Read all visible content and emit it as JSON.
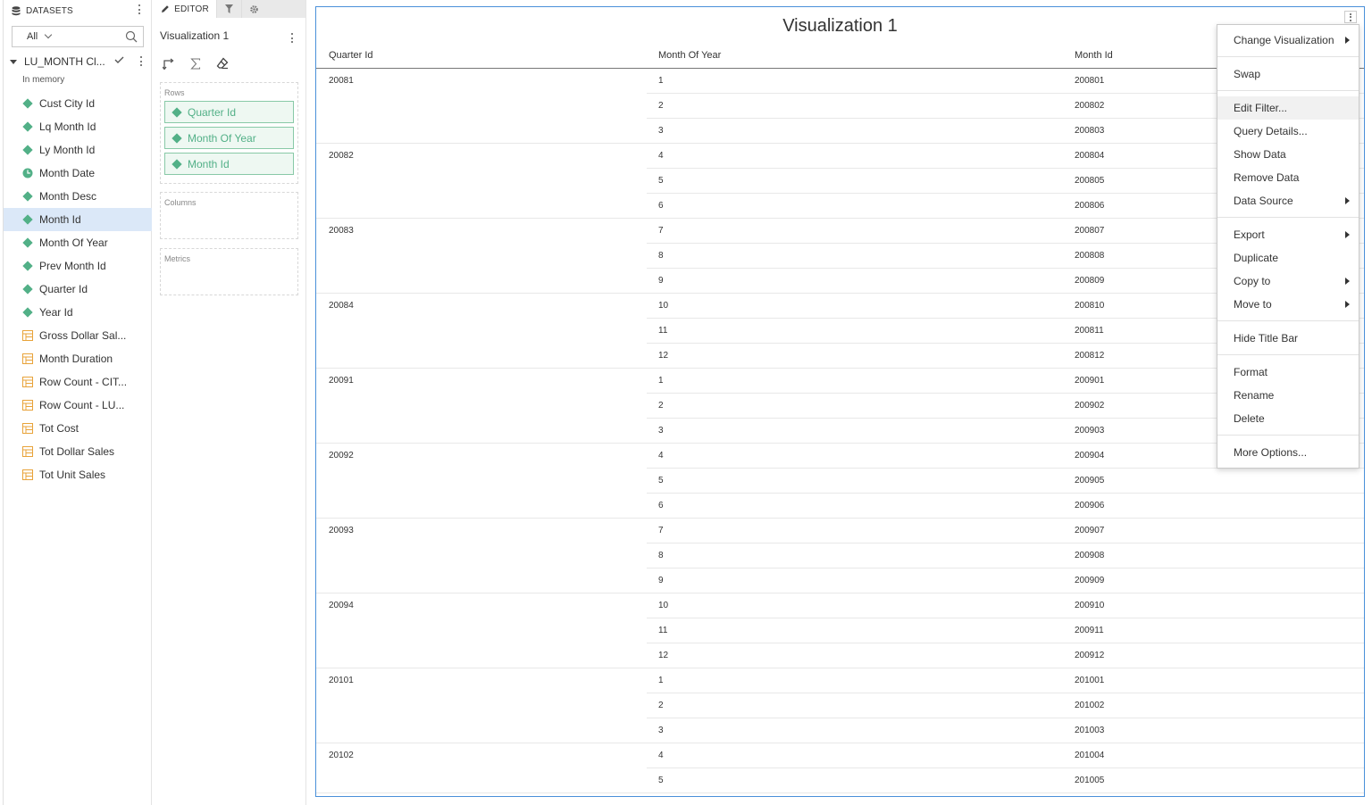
{
  "datasets_panel": {
    "header": "DATASETS",
    "filter_value": "All",
    "dataset_name": "LU_MONTH Cl...",
    "dataset_status": "In memory",
    "fields": [
      {
        "label": "Cust City Id",
        "type": "attribute"
      },
      {
        "label": "Lq Month Id",
        "type": "attribute"
      },
      {
        "label": "Ly Month Id",
        "type": "attribute"
      },
      {
        "label": "Month Date",
        "type": "time"
      },
      {
        "label": "Month Desc",
        "type": "attribute"
      },
      {
        "label": "Month Id",
        "type": "attribute",
        "selected": true
      },
      {
        "label": "Month Of Year",
        "type": "attribute"
      },
      {
        "label": "Prev Month Id",
        "type": "attribute"
      },
      {
        "label": "Quarter Id",
        "type": "attribute"
      },
      {
        "label": "Year Id",
        "type": "attribute"
      },
      {
        "label": "Gross Dollar Sal...",
        "type": "metric"
      },
      {
        "label": "Month Duration",
        "type": "metric"
      },
      {
        "label": "Row Count - CIT...",
        "type": "metric"
      },
      {
        "label": "Row Count - LU...",
        "type": "metric"
      },
      {
        "label": "Tot Cost",
        "type": "metric"
      },
      {
        "label": "Tot Dollar Sales",
        "type": "metric"
      },
      {
        "label": "Tot Unit Sales",
        "type": "metric"
      }
    ]
  },
  "editor_panel": {
    "tab_editor": "EDITOR",
    "viz_name": "Visualization 1",
    "rows_label": "Rows",
    "rows": [
      "Quarter Id",
      "Month Of Year",
      "Month Id"
    ],
    "columns_label": "Columns",
    "metrics_label": "Metrics"
  },
  "visualization": {
    "title": "Visualization 1",
    "headers": [
      "Quarter Id",
      "Month Of Year",
      "Month Id"
    ],
    "groups": [
      {
        "quarter": "20081",
        "rows": [
          [
            "1",
            "200801"
          ],
          [
            "2",
            "200802"
          ],
          [
            "3",
            "200803"
          ]
        ]
      },
      {
        "quarter": "20082",
        "rows": [
          [
            "4",
            "200804"
          ],
          [
            "5",
            "200805"
          ],
          [
            "6",
            "200806"
          ]
        ]
      },
      {
        "quarter": "20083",
        "rows": [
          [
            "7",
            "200807"
          ],
          [
            "8",
            "200808"
          ],
          [
            "9",
            "200809"
          ]
        ]
      },
      {
        "quarter": "20084",
        "rows": [
          [
            "10",
            "200810"
          ],
          [
            "11",
            "200811"
          ],
          [
            "12",
            "200812"
          ]
        ]
      },
      {
        "quarter": "20091",
        "rows": [
          [
            "1",
            "200901"
          ],
          [
            "2",
            "200902"
          ],
          [
            "3",
            "200903"
          ]
        ]
      },
      {
        "quarter": "20092",
        "rows": [
          [
            "4",
            "200904"
          ],
          [
            "5",
            "200905"
          ],
          [
            "6",
            "200906"
          ]
        ]
      },
      {
        "quarter": "20093",
        "rows": [
          [
            "7",
            "200907"
          ],
          [
            "8",
            "200908"
          ],
          [
            "9",
            "200909"
          ]
        ]
      },
      {
        "quarter": "20094",
        "rows": [
          [
            "10",
            "200910"
          ],
          [
            "11",
            "200911"
          ],
          [
            "12",
            "200912"
          ]
        ]
      },
      {
        "quarter": "20101",
        "rows": [
          [
            "1",
            "201001"
          ],
          [
            "2",
            "201002"
          ],
          [
            "3",
            "201003"
          ]
        ]
      },
      {
        "quarter": "20102",
        "rows": [
          [
            "4",
            "201004"
          ],
          [
            "5",
            "201005"
          ]
        ]
      }
    ]
  },
  "context_menu": {
    "items": [
      {
        "label": "Change Visualization",
        "submenu": true
      },
      {
        "separator": true
      },
      {
        "label": "Swap"
      },
      {
        "separator": true
      },
      {
        "label": "Edit Filter...",
        "highlighted": true
      },
      {
        "label": "Query Details..."
      },
      {
        "label": "Show Data"
      },
      {
        "label": "Remove Data"
      },
      {
        "label": "Data Source",
        "submenu": true
      },
      {
        "separator": true
      },
      {
        "label": "Export",
        "submenu": true
      },
      {
        "label": "Duplicate"
      },
      {
        "label": "Copy to",
        "submenu": true
      },
      {
        "label": "Move to",
        "submenu": true
      },
      {
        "separator": true
      },
      {
        "label": "Hide Title Bar"
      },
      {
        "separator": true
      },
      {
        "label": "Format"
      },
      {
        "label": "Rename"
      },
      {
        "label": "Delete"
      },
      {
        "separator": true
      },
      {
        "label": "More Options..."
      }
    ]
  },
  "colors": {
    "attribute_icon": "#52b087",
    "metric_icon": "#e8a33a",
    "selected_row": "#dbe8f8",
    "viz_border": "#4a90d9"
  }
}
